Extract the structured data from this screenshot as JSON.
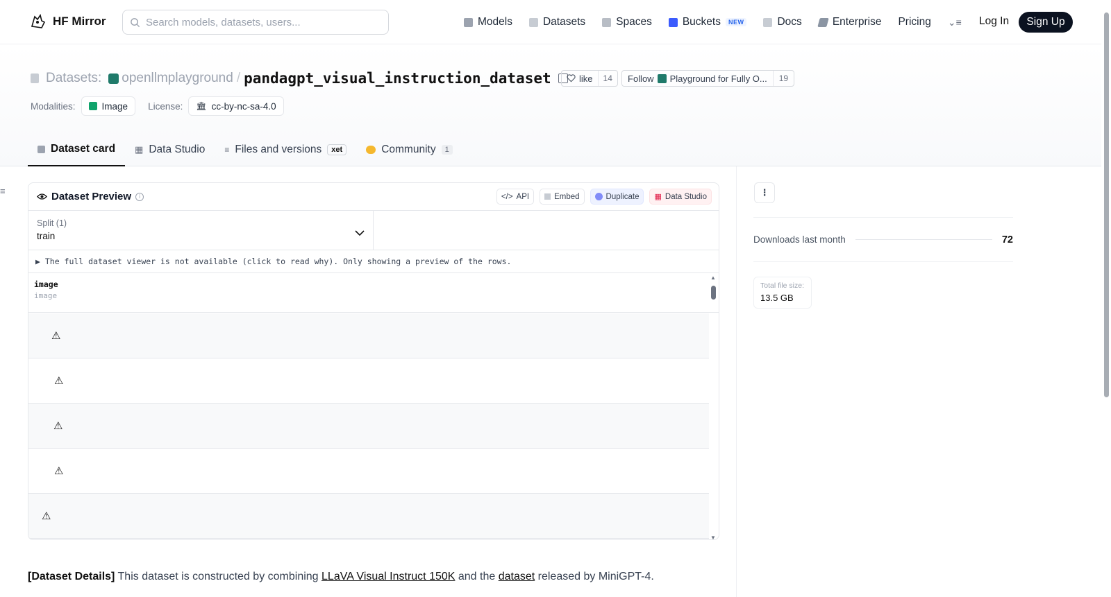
{
  "header": {
    "brand": "HF Mirror",
    "search_placeholder": "Search models, datasets, users...",
    "nav": [
      {
        "label": "Models",
        "icon": "cube-icon"
      },
      {
        "label": "Datasets",
        "icon": "database-icon"
      },
      {
        "label": "Spaces",
        "icon": "grid-icon"
      },
      {
        "label": "Buckets",
        "icon": "bucket-icon",
        "badge": "NEW"
      },
      {
        "label": "Docs",
        "icon": "book-icon"
      },
      {
        "label": "Enterprise",
        "icon": "enterprise-icon"
      },
      {
        "label": "Pricing"
      }
    ],
    "login": "Log In",
    "signup": "Sign Up"
  },
  "title": {
    "section": "Datasets:",
    "org": "openllmplayground",
    "separator": "/",
    "name": "pandagpt_visual_instruction_dataset",
    "like_label": "like",
    "like_count": "14",
    "follow_label": "Follow",
    "follow_org": "Playground for Fully O...",
    "follow_count": "19"
  },
  "meta": {
    "modalities_label": "Modalities:",
    "modality": "Image",
    "license_label": "License:",
    "license": "cc-by-nc-sa-4.0"
  },
  "tabs": [
    {
      "label": "Dataset card",
      "active": true
    },
    {
      "label": "Data Studio"
    },
    {
      "label": "Files and versions",
      "badge": "xet"
    },
    {
      "label": "Community",
      "count": "1"
    }
  ],
  "preview": {
    "title": "Dataset Preview",
    "actions": [
      "API",
      "Embed",
      "Duplicate",
      "Data Studio"
    ],
    "split_label": "Split (1)",
    "split_value": "train",
    "notice": "▶ The full dataset viewer is not available (click to read why). Only showing a preview of the rows.",
    "column_name": "image",
    "column_type": "image",
    "row_placeholder": "⚠"
  },
  "details": {
    "lead": "[Dataset Details]",
    "text1": " This dataset is constructed by combining ",
    "link1": "LLaVA Visual Instruct 150K",
    "text2": " and the ",
    "link2": "dataset",
    "text3": " released by MiniGPT-4."
  },
  "sidebar": {
    "downloads_label": "Downloads last month",
    "downloads_value": "72",
    "size_label": "Total file size:",
    "size_value": "13.5 GB"
  },
  "colors": {
    "brand_dark": "#0b1220",
    "accent_blue": "#2563eb",
    "org_teal": "#1f7a6a",
    "image_tag_green": "#10a36b"
  }
}
